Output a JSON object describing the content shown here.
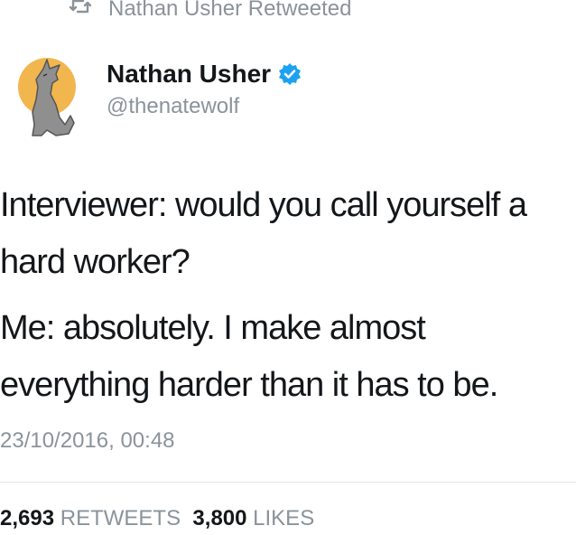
{
  "retweet_banner": {
    "text": "Nathan Usher Retweeted",
    "icon": "retweet-icon"
  },
  "author": {
    "display_name": "Nathan Usher",
    "handle": "@thenatewolf",
    "verified": true,
    "avatar_icon": "howling-wolf-moon-avatar"
  },
  "tweet": {
    "lines": [
      "Interviewer: would you call yourself a hard worker?",
      "Me: absolutely. I make almost everything harder than it has to be."
    ],
    "timestamp": "23/10/2016, 00:48"
  },
  "stats": {
    "retweets_count": "2,693",
    "retweets_label": "RETWEETS",
    "likes_count": "3,800",
    "likes_label": "LIKES"
  },
  "colors": {
    "text": "#14171a",
    "muted": "#8a939b",
    "verified": "#1da1f2",
    "moon": "#f2b64e"
  }
}
